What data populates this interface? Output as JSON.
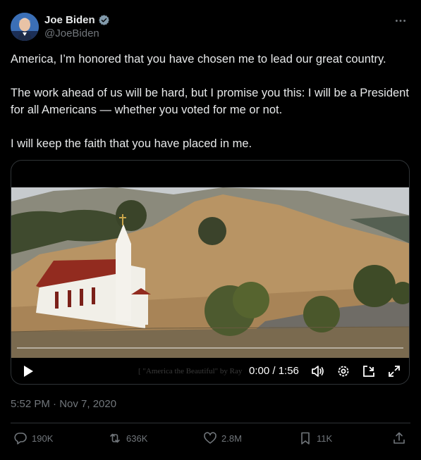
{
  "author": {
    "display_name": "Joe Biden",
    "handle": "@JoeBiden",
    "verified_icon": "verified-badge-icon"
  },
  "more_icon": "more-options-icon",
  "tweet": {
    "paragraphs": [
      "America, I’m honored that you have chosen me to lead our great country.",
      "The work ahead of us will be hard, but I promise you this: I will be a President for all Americans — whether you voted for me or not.",
      "I will keep the faith that you have placed in me."
    ]
  },
  "video": {
    "time": "0:00 / 1:56",
    "caption_overlay": "[ \"America the Beautiful\" by Ray",
    "progress": 0.0,
    "icons": [
      "play-icon",
      "volume-icon",
      "settings-icon",
      "picture-in-picture-icon",
      "fullscreen-icon"
    ]
  },
  "meta": {
    "timestamp": "5:52 PM · Nov 7, 2020"
  },
  "actions": {
    "replies": "190K",
    "reposts": "636K",
    "likes": "2.8M",
    "bookmarks": "11K"
  },
  "colors": {
    "background": "#000000",
    "text": "#e7e9ea",
    "muted": "#71767b",
    "border": "#2f3336",
    "verified": "#829aab"
  }
}
